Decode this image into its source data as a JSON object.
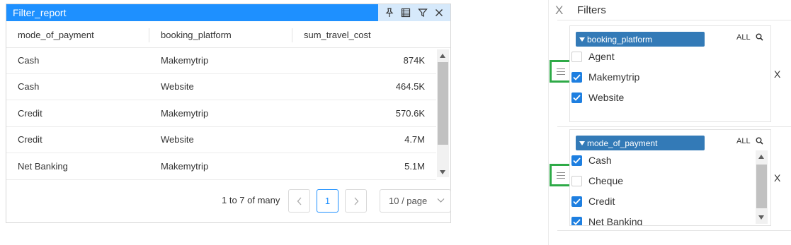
{
  "report": {
    "title": "Filter_report",
    "columns": [
      "mode_of_payment",
      "booking_platform",
      "sum_travel_cost"
    ],
    "rows": [
      [
        "Cash",
        "Makemytrip",
        "874K"
      ],
      [
        "Cash",
        "Website",
        "464.5K"
      ],
      [
        "Credit",
        "Makemytrip",
        "570.6K"
      ],
      [
        "Credit",
        "Website",
        "4.7M"
      ],
      [
        "Net Banking",
        "Makemytrip",
        "5.1M"
      ]
    ],
    "pagination": {
      "range_text": "1 to 7 of many",
      "current_page": "1",
      "page_size": "10 / page"
    },
    "tools": [
      "pin-icon",
      "table-icon",
      "filter-icon",
      "close-icon"
    ],
    "header_color": "#1e90ff"
  },
  "filters": {
    "close_label": "X",
    "title": "Filters",
    "groups": [
      {
        "field": "booking_platform",
        "all_label": "ALL",
        "options": [
          {
            "label": "Agent",
            "checked": false
          },
          {
            "label": "Makemytrip",
            "checked": true
          },
          {
            "label": "Website",
            "checked": true
          }
        ],
        "remove_label": "X"
      },
      {
        "field": "mode_of_payment",
        "all_label": "ALL",
        "options": [
          {
            "label": "Cash",
            "checked": true
          },
          {
            "label": "Cheque",
            "checked": false
          },
          {
            "label": "Credit",
            "checked": true
          },
          {
            "label": "Net Banking",
            "checked": true
          }
        ],
        "remove_label": "X"
      }
    ],
    "chip_color": "#337ab7",
    "checkbox_color": "#1e7fe0",
    "handle_highlight_color": "#2eaa47"
  }
}
